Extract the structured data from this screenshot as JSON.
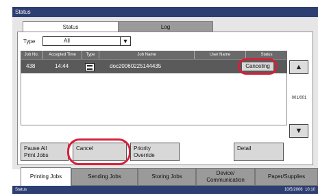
{
  "window": {
    "title": "Status"
  },
  "tabs": {
    "status": "Status",
    "log": "Log"
  },
  "filter": {
    "label": "Type",
    "value": "All",
    "arrow": "▼"
  },
  "table": {
    "headers": [
      "Job No.",
      "Accepted Time",
      "Type",
      "Job Name",
      "User Name",
      "Status"
    ],
    "rows": [
      {
        "job_no": "438",
        "time": "14:44",
        "type_icon": "document-icon",
        "name": "doc20060225144435",
        "user": "",
        "status": "Canceling"
      }
    ]
  },
  "scroll": {
    "up": "▲",
    "down": "▼",
    "page": "001/001"
  },
  "actions": {
    "pause_all": "Pause All\nPrint Jobs",
    "cancel": "Cancel",
    "priority": "Priority\nOverride",
    "detail": "Detail"
  },
  "bottom_tabs": [
    "Printing Jobs",
    "Sending Jobs",
    "Storing Jobs",
    "Device/\nCommunication",
    "Paper/Supplies"
  ],
  "statusbar": {
    "left": "Status",
    "date": "10/5/2006",
    "time": "10:10"
  },
  "highlight_color": "#d71f3a"
}
